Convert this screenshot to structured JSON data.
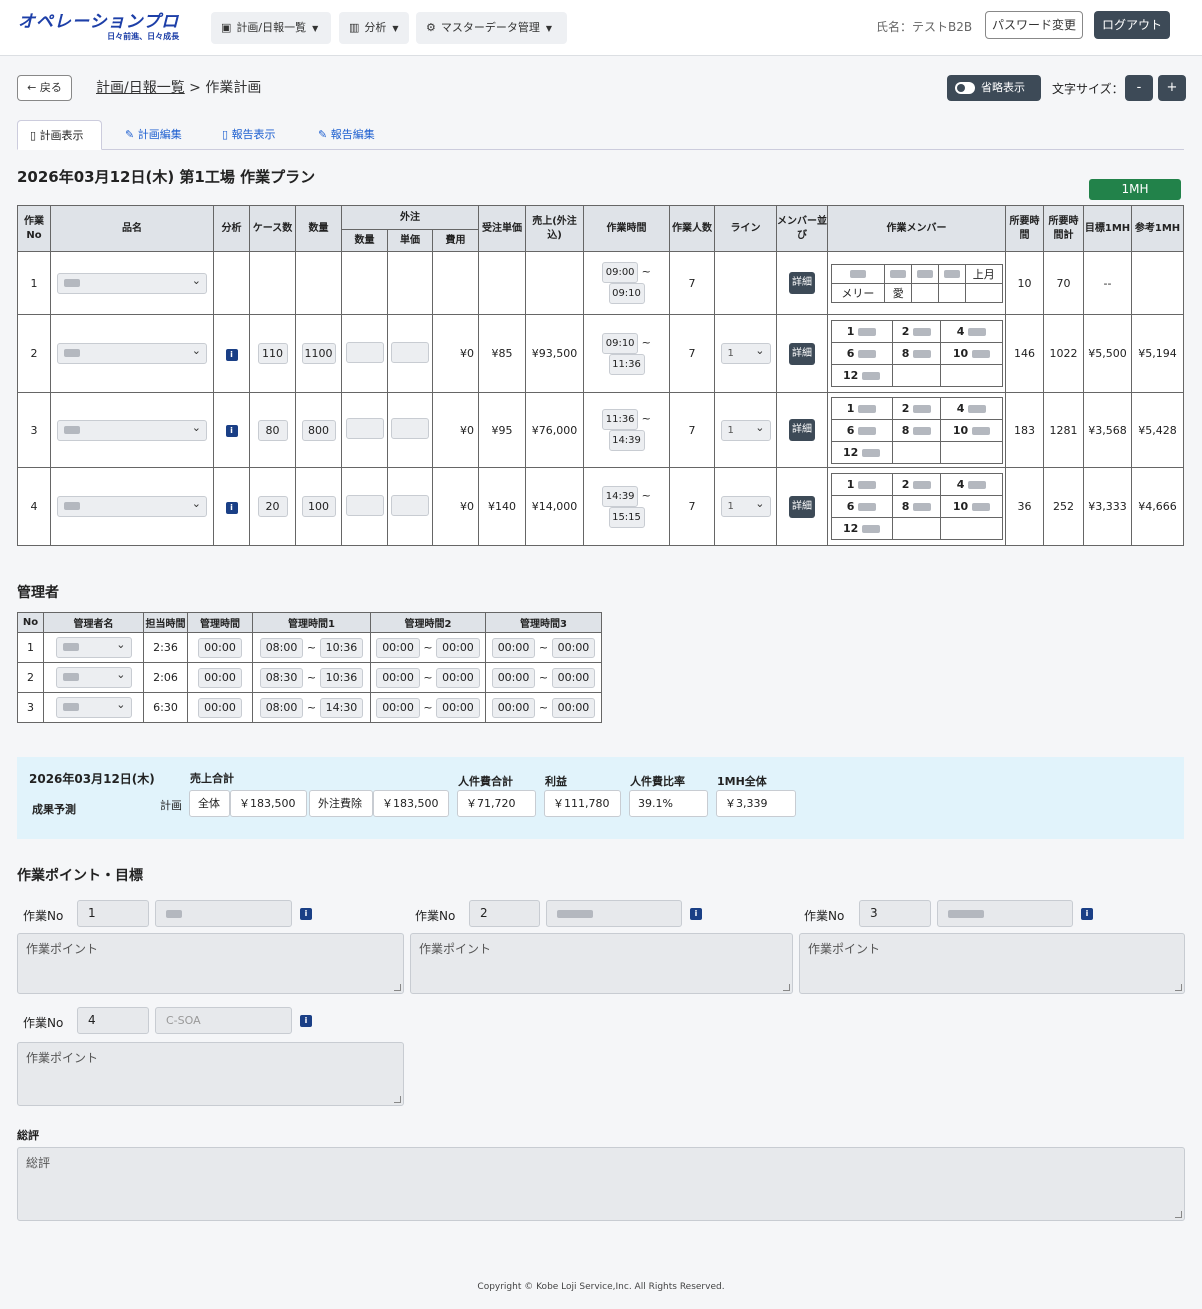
{
  "header": {
    "logo": "オペレーションプロ",
    "logo_sub": "日々前進、日々成長",
    "nav": [
      {
        "label": "計画/日報一覧",
        "icon": "calendar-icon"
      },
      {
        "label": "分析",
        "icon": "chart-icon"
      },
      {
        "label": "マスターデータ管理",
        "icon": "gear-icon"
      }
    ],
    "user": "氏名：テストB2B",
    "password_btn": "パスワード変更",
    "logout_btn": "ログアウト"
  },
  "toolbar": {
    "back": "戻る",
    "breadcrumb_link": "計画/日報一覧",
    "breadcrumb_sep": " > ",
    "breadcrumb_current": "作業計画",
    "compact": "省略表示",
    "font_size": "文字サイズ：",
    "minus": "-",
    "plus": "+"
  },
  "tabs": [
    {
      "label": "計画表示",
      "icon": "doc-icon"
    },
    {
      "label": "計画編集",
      "icon": "pencil-icon"
    },
    {
      "label": "報告表示",
      "icon": "doc-icon"
    },
    {
      "label": "報告編集",
      "icon": "pencil-icon"
    }
  ],
  "plan": {
    "title": "2026年03月12日(木) 第1工場 作業プラン",
    "badge": "1MH",
    "headers": {
      "no": "作業No",
      "product": "品名",
      "analysis": "分析",
      "cases": "ケース数",
      "qty": "数量",
      "outsource": "外注",
      "os_qty": "数量",
      "os_unit": "単価",
      "os_cost": "費用",
      "order_price": "受注単価",
      "sales": "売上(外注込)",
      "work_time": "作業時間",
      "workers": "作業人数",
      "line": "ライン",
      "member_order": "メンバー並び",
      "members": "作業メンバー",
      "req_time": "所要時間",
      "req_total": "所要時間計",
      "target_mh": "目標1MH",
      "ref_mh": "参考1MH"
    },
    "detail_label": "詳細",
    "rows": [
      {
        "no": "1",
        "product": "",
        "cases": "",
        "qty": "",
        "os_cost": "",
        "order_price": "",
        "sales": "",
        "time_from": "09:00",
        "time_to": "09:10",
        "workers": "7",
        "line": "",
        "req": "10",
        "req_total": "70",
        "target": "--",
        "ref": ""
      },
      {
        "no": "2",
        "product": "",
        "cases": "110",
        "qty": "1100",
        "os_cost": "¥0",
        "order_price": "¥85",
        "sales": "¥93,500",
        "time_from": "09:10",
        "time_to": "11:36",
        "workers": "7",
        "line": "1",
        "req": "146",
        "req_total": "1022",
        "target": "¥5,500",
        "ref": "¥5,194"
      },
      {
        "no": "3",
        "product": "",
        "cases": "80",
        "qty": "800",
        "os_cost": "¥0",
        "order_price": "¥95",
        "sales": "¥76,000",
        "time_from": "11:36",
        "time_to": "14:39",
        "workers": "7",
        "line": "1",
        "req": "183",
        "req_total": "1281",
        "target": "¥3,568",
        "ref": "¥5,428"
      },
      {
        "no": "4",
        "product": "",
        "cases": "20",
        "qty": "100",
        "os_cost": "¥0",
        "order_price": "¥140",
        "sales": "¥14,000",
        "time_from": "14:39",
        "time_to": "15:15",
        "workers": "7",
        "line": "1",
        "req": "36",
        "req_total": "252",
        "target": "¥3,333",
        "ref": "¥4,666"
      }
    ],
    "member_nums": [
      "1",
      "2",
      "4",
      "6",
      "8",
      "10",
      "12"
    ],
    "member_row1": [
      "メリー",
      "愛",
      "上月"
    ]
  },
  "managers": {
    "title": "管理者",
    "headers": [
      "No",
      "管理者名",
      "担当時間",
      "管理時間",
      "管理時間1",
      "管理時間2",
      "管理時間3"
    ],
    "rows": [
      {
        "no": "1",
        "assigned": "2:36",
        "mgmt": "00:00",
        "t1a": "08:00",
        "t1b": "10:36",
        "t2a": "00:00",
        "t2b": "00:00",
        "t3a": "00:00",
        "t3b": "00:00"
      },
      {
        "no": "2",
        "assigned": "2:06",
        "mgmt": "00:00",
        "t1a": "08:30",
        "t1b": "10:36",
        "t2a": "00:00",
        "t2b": "00:00",
        "t3a": "00:00",
        "t3b": "00:00"
      },
      {
        "no": "3",
        "assigned": "6:30",
        "mgmt": "00:00",
        "t1a": "08:00",
        "t1b": "14:30",
        "t2a": "00:00",
        "t2b": "00:00",
        "t3a": "00:00",
        "t3b": "00:00"
      }
    ]
  },
  "summary": {
    "date": "2026年03月12日(木)",
    "subtitle": "成果予測",
    "plan_label": "計画",
    "sales_total_label": "売上合計",
    "all_label": "全体",
    "all_value": "￥183,500",
    "ex_os_label": "外注費除",
    "ex_os_value": "￥183,500",
    "labor_label": "人件費合計",
    "labor_value": "￥71,720",
    "profit_label": "利益",
    "profit_value": "￥111,780",
    "ratio_label": "人件費比率",
    "ratio_value": "39.1%",
    "mh_label": "1MH全体",
    "mh_value": "￥3,339"
  },
  "points": {
    "title": "作業ポイント・目標",
    "no_label": "作業No",
    "placeholder": "作業ポイント",
    "items": [
      {
        "no": "1"
      },
      {
        "no": "2"
      },
      {
        "no": "3"
      },
      {
        "no": "4",
        "name": "C-SOA"
      }
    ],
    "overall_label": "総評",
    "overall_placeholder": "総評"
  },
  "footer": "Copyright © Kobe Loji Service,Inc. All Rights Reserved."
}
